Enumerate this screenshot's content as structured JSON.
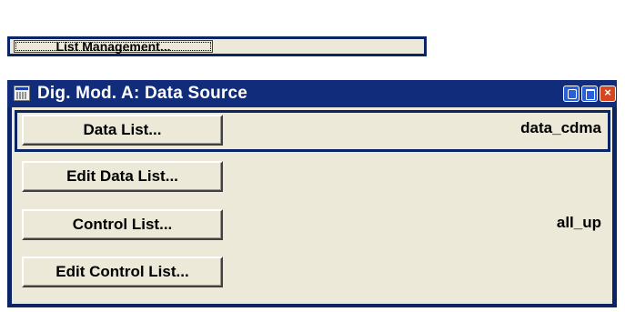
{
  "list_management": {
    "button_label": "List Management..."
  },
  "window": {
    "title": "Dig. Mod.  A: Data Source",
    "title_icon": "window-app-icon",
    "controls": [
      "minimize-icon",
      "maximize-icon",
      "close-icon"
    ],
    "close_glyph": "×"
  },
  "rows": [
    {
      "button_label": "Data List...",
      "value": "data_cdma"
    },
    {
      "button_label": "Edit Data List...",
      "value": ""
    },
    {
      "button_label": "Control List...",
      "value": "all_up"
    },
    {
      "button_label": "Edit Control List...",
      "value": ""
    }
  ],
  "colors": {
    "frame": "#0a2466",
    "titlebar": "#102c7a",
    "panel": "#ece9d8",
    "close_button": "#d7461e"
  }
}
